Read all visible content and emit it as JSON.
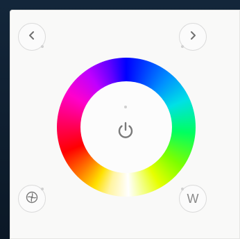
{
  "controller": {
    "prev_icon": "chevron-left-icon",
    "next_icon": "chevron-right-icon",
    "mode_icon": "mode-pinwheel-icon",
    "power_icon": "power-icon",
    "white_button_label": "W",
    "colors": {
      "panel": "#f9f9f8",
      "icon": "#8e8e8e",
      "button_border": "#dadada",
      "frame": "#0e1c2a"
    }
  }
}
